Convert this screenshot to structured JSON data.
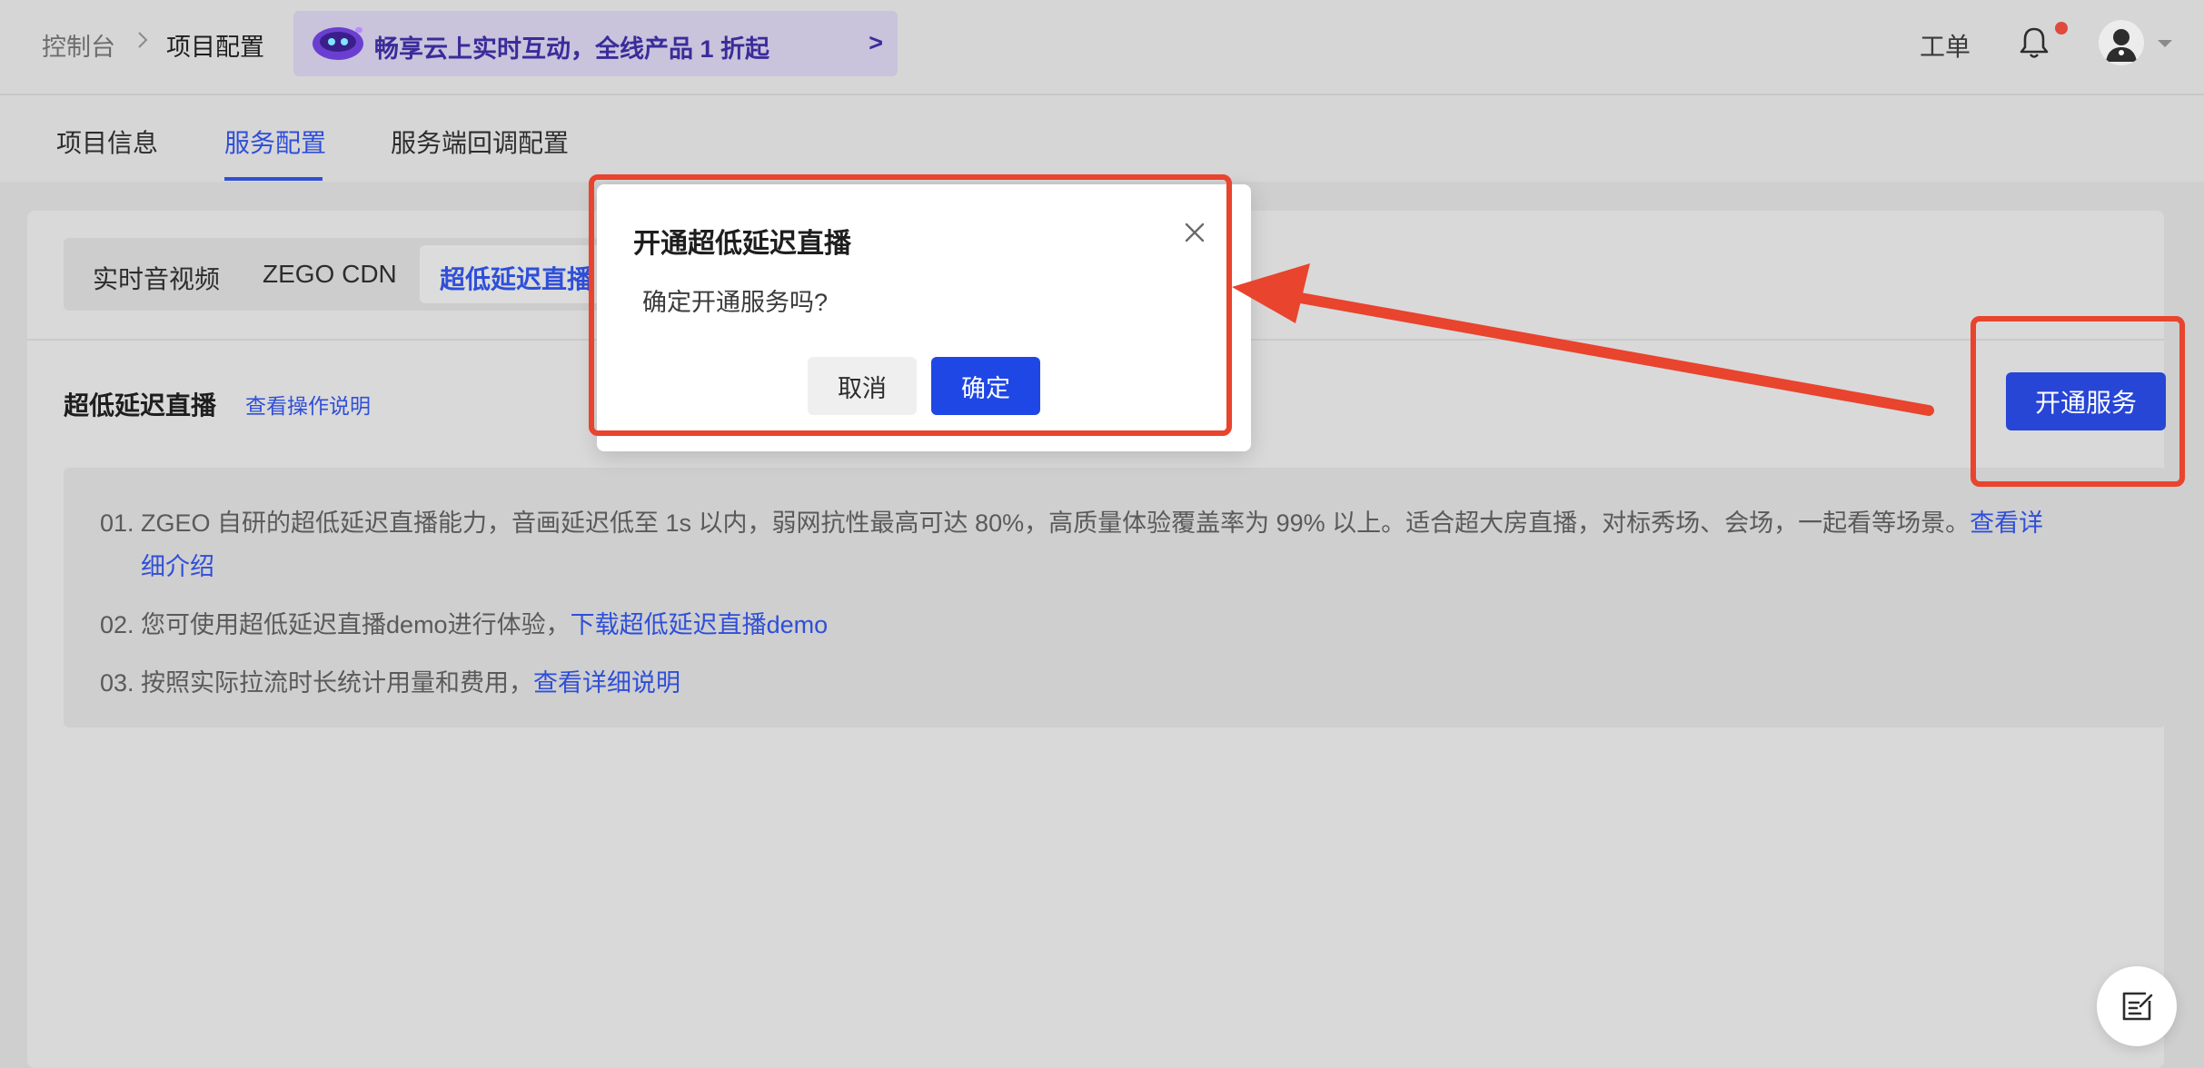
{
  "header": {
    "breadcrumb_root": "控制台",
    "breadcrumb_current": "项目配置",
    "promo_text": "畅享云上实时互动，全线产品 1 折起",
    "promo_arrow": ">",
    "ticket_label": "工单"
  },
  "tabs": [
    {
      "label": "项目信息"
    },
    {
      "label": "服务配置"
    },
    {
      "label": "服务端回调配置"
    }
  ],
  "subtabs": [
    {
      "label": "实时音视频"
    },
    {
      "label": "ZEGO CDN"
    },
    {
      "label": "超低延迟直播"
    }
  ],
  "section": {
    "title": "超低延迟直播",
    "help_link": "查看操作说明",
    "open_button": "开通服务"
  },
  "info": {
    "line1_text": "01. ZGEO 自研的超低延迟直播能力，音画延迟低至 1s 以内，弱网抗性最高可达 80%，高质量体验覆盖率为 99% 以上。适合超大房直播，对标秀场、会场，一起看等场景。",
    "line1_link_a": "查看详",
    "line1_link_b": "细介绍",
    "line2_text": "02. 您可使用超低延迟直播demo进行体验，",
    "line2_link": "下载超低延迟直播demo",
    "line3_text": "03. 按照实际拉流时长统计用量和费用，",
    "line3_link": "查看详细说明"
  },
  "modal": {
    "title": "开通超低延迟直播",
    "body": "确定开通服务吗?",
    "cancel": "取消",
    "confirm": "确定"
  },
  "colors": {
    "accent": "#2f4fd8",
    "primary_button": "#1f47e6",
    "annotation": "#e8442e"
  },
  "icons": {
    "close": "close-icon",
    "bell": "bell-icon",
    "feedback": "edit-note-icon"
  }
}
